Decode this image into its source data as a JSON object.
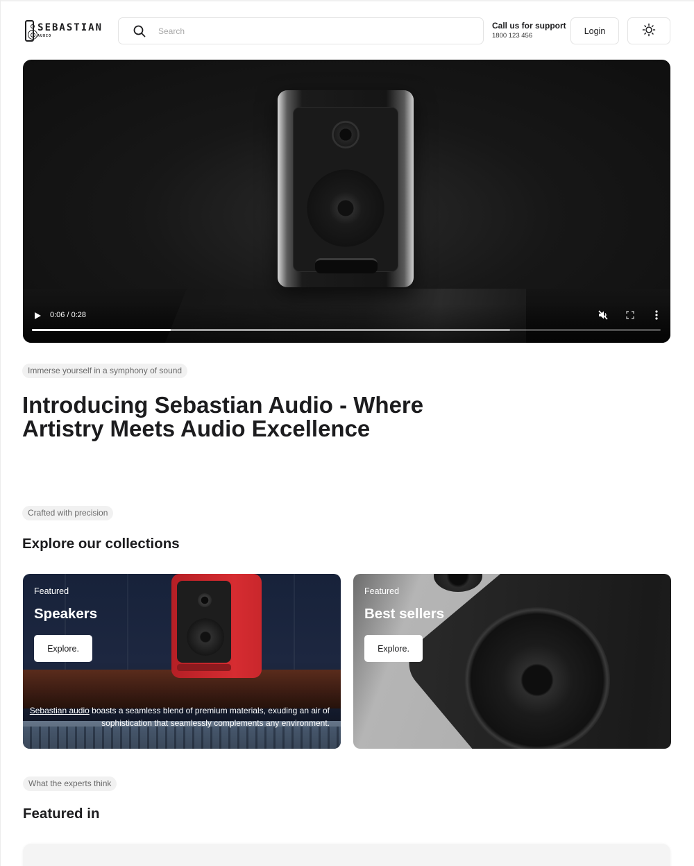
{
  "header": {
    "logo_name": "SEBASTIAN",
    "logo_sub": "AUDIO",
    "search_placeholder": "Search",
    "support_title": "Call us for support",
    "support_phone": "1800 123 456",
    "login_label": "Login",
    "theme_icon": "sun-icon"
  },
  "video": {
    "time": "0:06 / 0:28",
    "played_fraction": 0.2208,
    "buffered_fraction": 0.7605,
    "muted": true,
    "controls": [
      "play-icon",
      "mute-icon",
      "fullscreen-icon",
      "more-vertical-icon"
    ]
  },
  "intro": {
    "tag": "Immerse yourself in a symphony of sound",
    "title_line1": "Introducing Sebastian Audio - Where",
    "title_line2": "Artistry Meets Audio Excellence"
  },
  "collections": {
    "tag": "Crafted with precision",
    "title": "Explore our collections",
    "cards": [
      {
        "label": "Featured",
        "title": "Speakers",
        "button": "Explore.",
        "caption_link": "Sebastian audio",
        "caption_rest": " boasts a seamless blend of premium materials, exuding an air of sophistication that seamlessly complements any environment."
      },
      {
        "label": "Featured",
        "title": "Best sellers",
        "button": "Explore."
      }
    ]
  },
  "featured": {
    "tag": "What the experts think",
    "title": "Featured in"
  },
  "colors": {
    "text": "#1c1c1e",
    "pill_bg": "#f1f1f1",
    "pill_text": "#6a6a6a",
    "border": "#e3e3e3",
    "card1_speaker": "#d62c31"
  }
}
